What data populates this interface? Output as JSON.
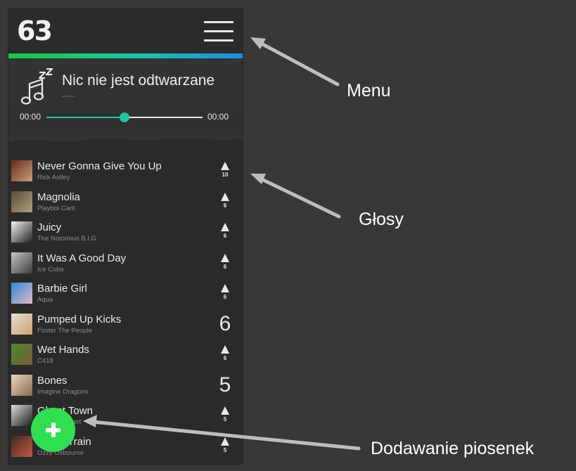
{
  "app": {
    "logo_text": "63"
  },
  "player": {
    "title": "Nic nie jest odtwarzane",
    "artist": "-----",
    "time_current": "00:00",
    "time_total": "00:00",
    "progress_fraction": 0.5
  },
  "songs": [
    {
      "title": "Never Gonna Give You Up",
      "artist": "Rick Astley",
      "votes": "10",
      "big": false,
      "thumb_colors": [
        "#6b2a1a",
        "#c8a07a"
      ]
    },
    {
      "title": "Magnolia",
      "artist": "Playboi Carti",
      "votes": "6",
      "big": false,
      "thumb_colors": [
        "#5a4a3a",
        "#b0a080"
      ]
    },
    {
      "title": "Juicy",
      "artist": "The Notorious B.I.G.",
      "votes": "6",
      "big": false,
      "thumb_colors": [
        "#f2f2f2",
        "#222222"
      ]
    },
    {
      "title": "It Was A Good Day",
      "artist": "Ice Cube",
      "votes": "6",
      "big": false,
      "thumb_colors": [
        "#c8c8c8",
        "#3a3a3a"
      ]
    },
    {
      "title": "Barbie Girl",
      "artist": "Aqua",
      "votes": "6",
      "big": false,
      "thumb_colors": [
        "#2a8ad8",
        "#e8b8c8"
      ]
    },
    {
      "title": "Pumped Up Kicks",
      "artist": "Foster The People",
      "votes": "6",
      "big": true,
      "thumb_colors": [
        "#e8e0d0",
        "#c8a070"
      ]
    },
    {
      "title": "Wet Hands",
      "artist": "C418",
      "votes": "6",
      "big": false,
      "thumb_colors": [
        "#4a8a2a",
        "#7a5a3a"
      ]
    },
    {
      "title": "Bones",
      "artist": "Imagine Dragons",
      "votes": "5",
      "big": true,
      "thumb_colors": [
        "#e8d8c0",
        "#8a6a4a"
      ]
    },
    {
      "title": "Ghost Town",
      "artist": "Adam Lambert",
      "votes": "5",
      "big": false,
      "thumb_colors": [
        "#dcdcdc",
        "#1a1a1a"
      ]
    },
    {
      "title": "Crazy Train",
      "artist": "Ozzy Osbourne",
      "votes": "5",
      "big": false,
      "thumb_colors": [
        "#3a2a2a",
        "#c85a3a"
      ]
    }
  ],
  "annotations": {
    "menu": "Menu",
    "votes": "Głosy",
    "add_songs": "Dodawanie piosenek"
  },
  "colors": {
    "accent": "#1cc6a0",
    "fab": "#2ee04f",
    "gradient_start": "#18c93e",
    "gradient_end": "#1a8fe6"
  },
  "icons": {
    "menu": "hamburger-icon",
    "now_playing": "sleeping-music-note-icon",
    "vote": "upvote-arrow-icon",
    "add": "plus-icon"
  }
}
